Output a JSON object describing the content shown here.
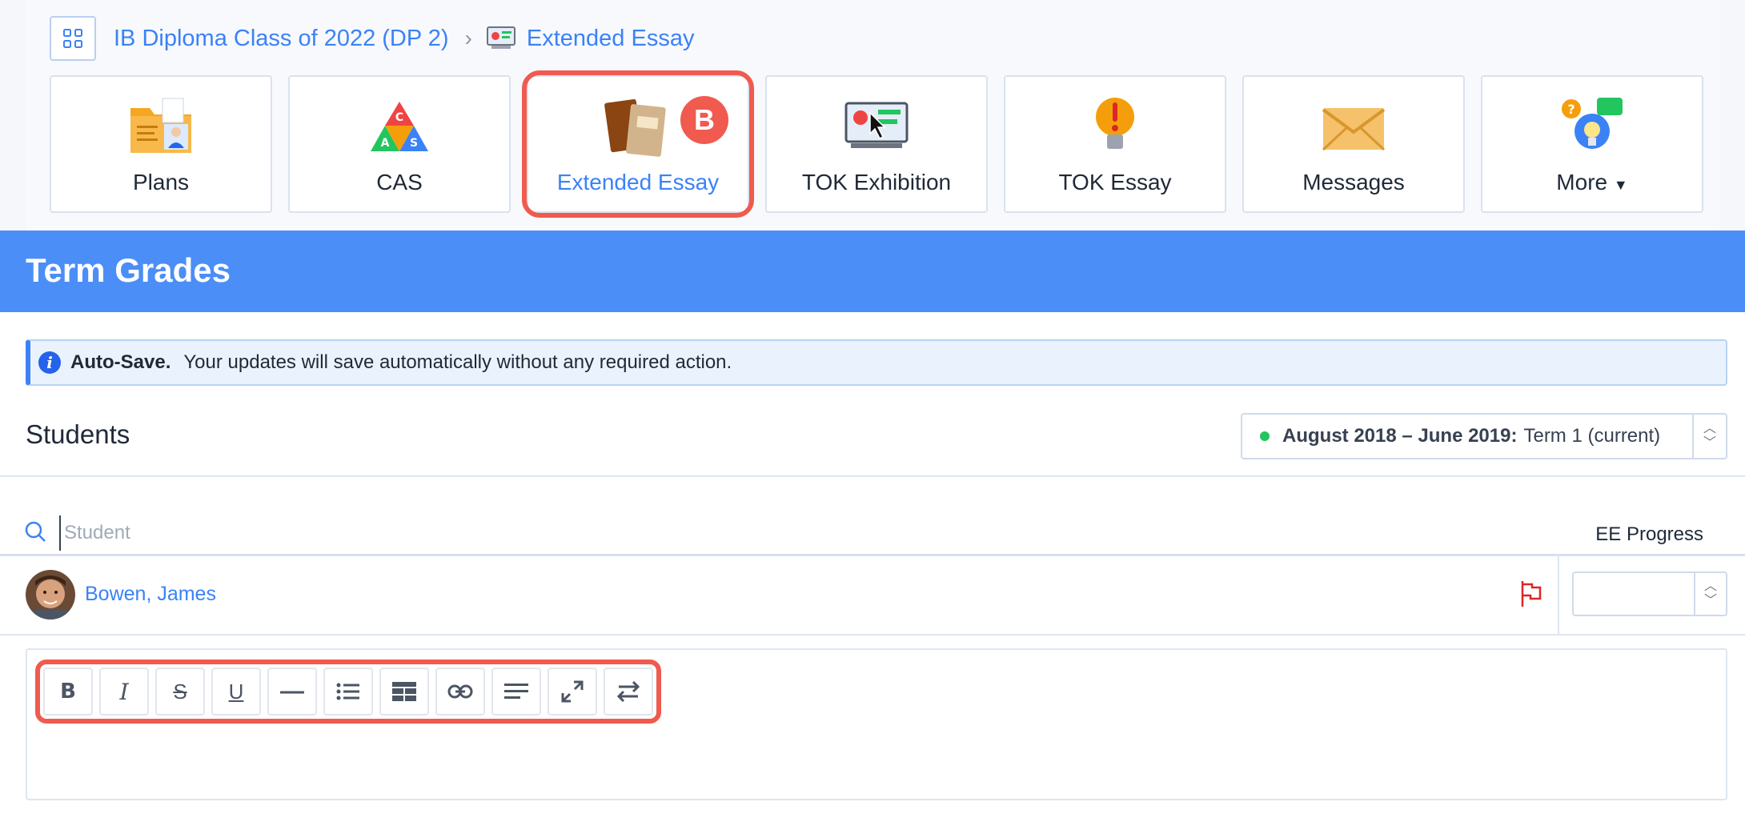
{
  "breadcrumb": {
    "class_link": "IB Diploma Class of 2022 (DP 2)",
    "separator": "›",
    "current": "Extended Essay"
  },
  "tiles": [
    {
      "label": "Plans",
      "icon": "folder-person-icon"
    },
    {
      "label": "CAS",
      "icon": "cas-triangle-icon"
    },
    {
      "label": "Extended Essay",
      "icon": "books-icon",
      "active": true,
      "badge": "B"
    },
    {
      "label": "TOK Exhibition",
      "icon": "presentation-icon"
    },
    {
      "label": "TOK Essay",
      "icon": "lightbulb-icon"
    },
    {
      "label": "Messages",
      "icon": "envelope-icon"
    },
    {
      "label": "More",
      "icon": "chat-bubbles-icon"
    }
  ],
  "banner": {
    "title": "Term Grades"
  },
  "alert": {
    "title": "Auto-Save.",
    "message": "Your updates will save automatically without any required action."
  },
  "students": {
    "title": "Students",
    "term": {
      "range": "August 2018 – June 2019:",
      "term": "Term 1 (current)"
    },
    "search_placeholder": "Student",
    "progress_header": "EE Progress",
    "rows": [
      {
        "name": "Bowen, James"
      }
    ]
  },
  "toolbar": {
    "buttons": [
      {
        "name": "bold-button",
        "glyph": "B"
      },
      {
        "name": "italic-button",
        "glyph": "I"
      },
      {
        "name": "strikethrough-button",
        "glyph": "S"
      },
      {
        "name": "underline-button",
        "glyph": "U"
      },
      {
        "name": "horizontal-rule-button",
        "glyph": "—"
      },
      {
        "name": "bullet-list-button",
        "glyph": ""
      },
      {
        "name": "table-button",
        "glyph": ""
      },
      {
        "name": "link-button",
        "glyph": ""
      },
      {
        "name": "align-button",
        "glyph": ""
      },
      {
        "name": "fullscreen-button",
        "glyph": ""
      },
      {
        "name": "toggle-direction-button",
        "glyph": ""
      }
    ]
  },
  "colors": {
    "accent": "#3b82f6",
    "banner": "#4b8ef7",
    "highlight": "#f05a4f",
    "status_green": "#22c55e"
  }
}
